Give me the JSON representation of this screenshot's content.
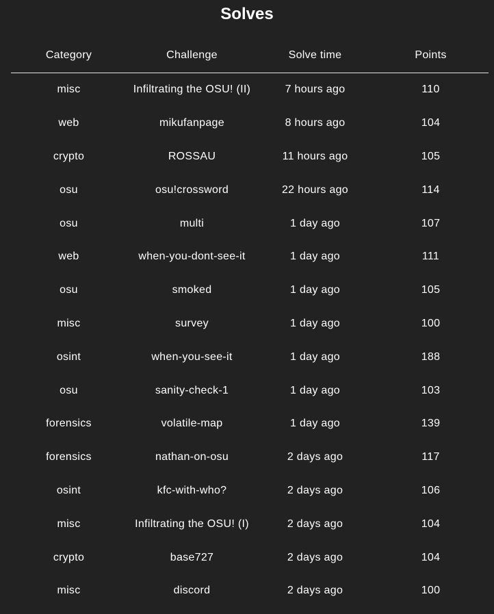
{
  "title": "Solves",
  "columns": [
    "Category",
    "Challenge",
    "Solve time",
    "Points"
  ],
  "rows": [
    {
      "category": "misc",
      "challenge": "Infiltrating the OSU! (II)",
      "solve_time": "7 hours ago",
      "points": "110"
    },
    {
      "category": "web",
      "challenge": "mikufanpage",
      "solve_time": "8 hours ago",
      "points": "104"
    },
    {
      "category": "crypto",
      "challenge": "ROSSAU",
      "solve_time": "11 hours ago",
      "points": "105"
    },
    {
      "category": "osu",
      "challenge": "osu!crossword",
      "solve_time": "22 hours ago",
      "points": "114"
    },
    {
      "category": "osu",
      "challenge": "multi",
      "solve_time": "1 day ago",
      "points": "107"
    },
    {
      "category": "web",
      "challenge": "when-you-dont-see-it",
      "solve_time": "1 day ago",
      "points": "111"
    },
    {
      "category": "osu",
      "challenge": "smoked",
      "solve_time": "1 day ago",
      "points": "105"
    },
    {
      "category": "misc",
      "challenge": "survey",
      "solve_time": "1 day ago",
      "points": "100"
    },
    {
      "category": "osint",
      "challenge": "when-you-see-it",
      "solve_time": "1 day ago",
      "points": "188"
    },
    {
      "category": "osu",
      "challenge": "sanity-check-1",
      "solve_time": "1 day ago",
      "points": "103"
    },
    {
      "category": "forensics",
      "challenge": "volatile-map",
      "solve_time": "1 day ago",
      "points": "139"
    },
    {
      "category": "forensics",
      "challenge": "nathan-on-osu",
      "solve_time": "2 days ago",
      "points": "117"
    },
    {
      "category": "osint",
      "challenge": "kfc-with-who?",
      "solve_time": "2 days ago",
      "points": "106"
    },
    {
      "category": "misc",
      "challenge": "Infiltrating the OSU! (I)",
      "solve_time": "2 days ago",
      "points": "104"
    },
    {
      "category": "crypto",
      "challenge": "base727",
      "solve_time": "2 days ago",
      "points": "104"
    },
    {
      "category": "misc",
      "challenge": "discord",
      "solve_time": "2 days ago",
      "points": "100"
    }
  ]
}
